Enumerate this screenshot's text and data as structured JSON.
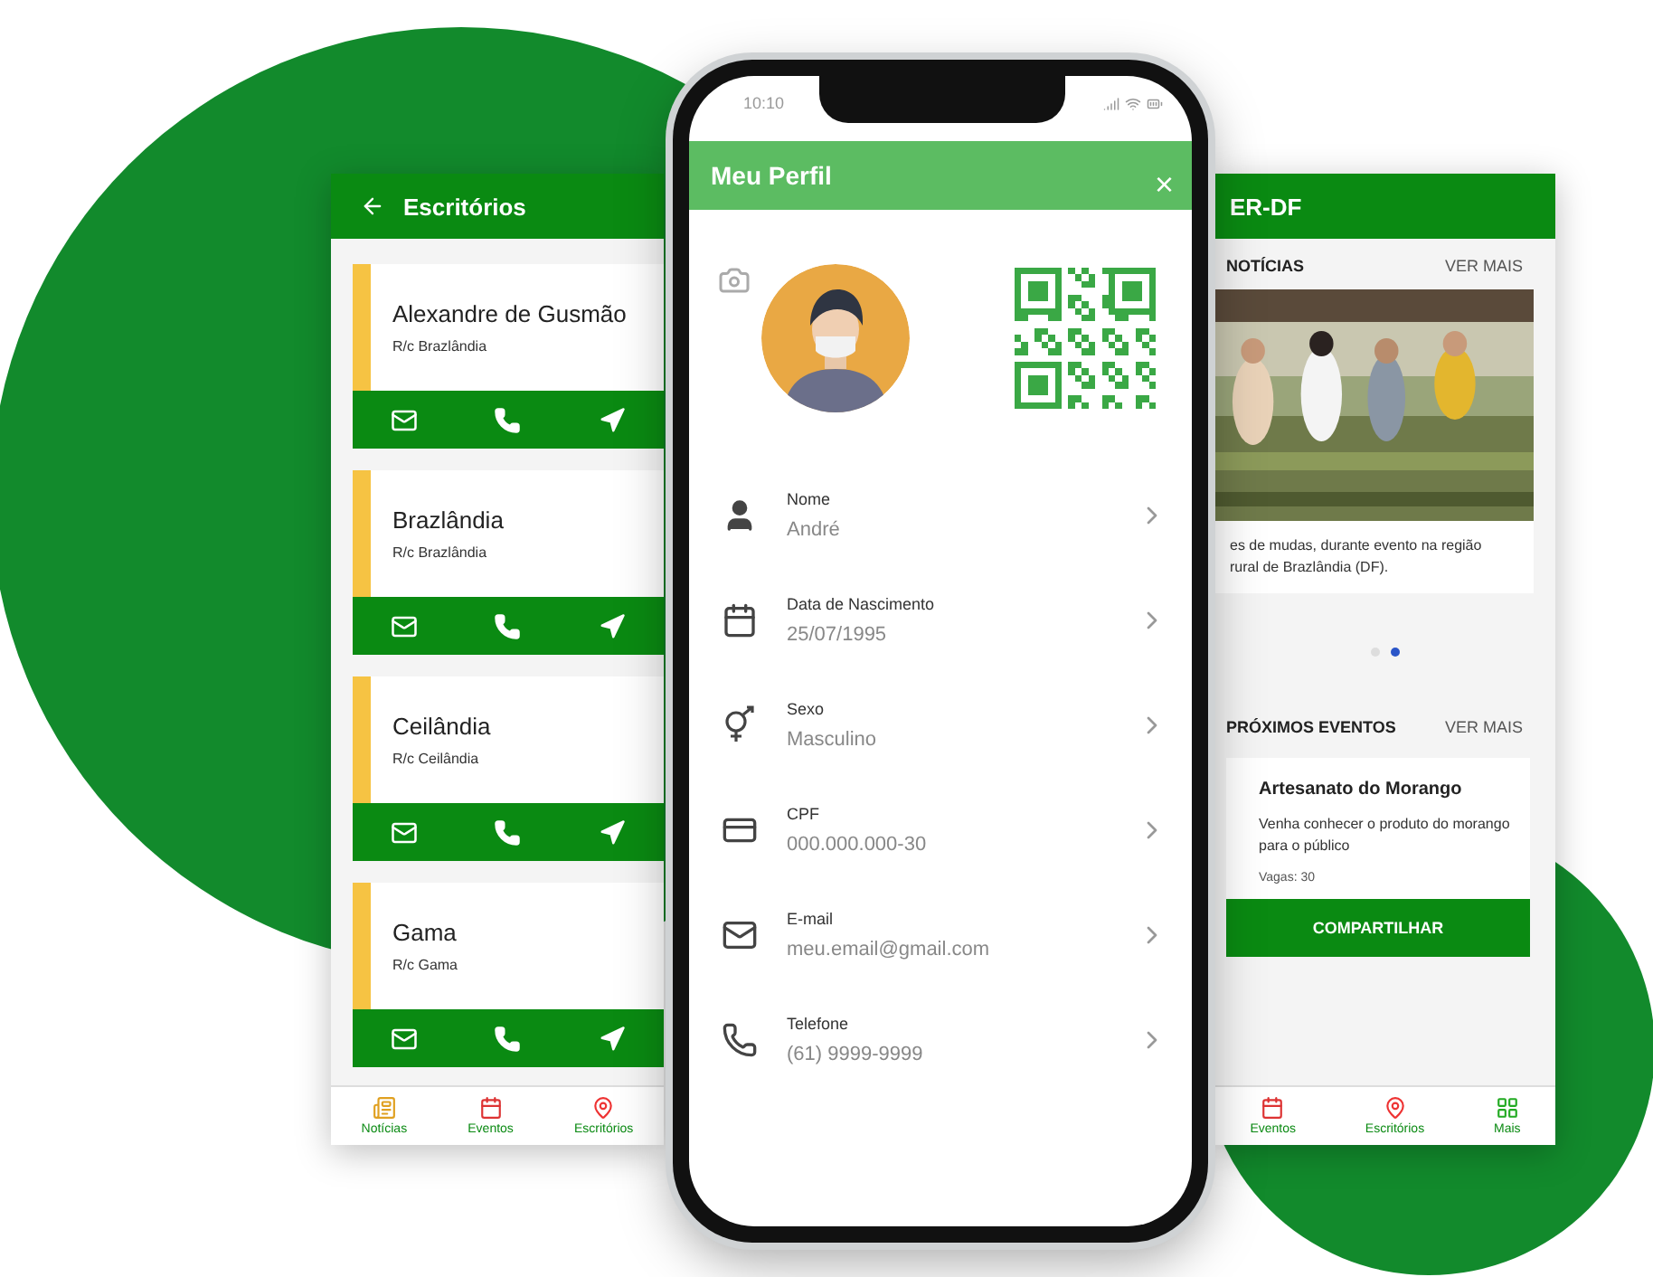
{
  "offices_screen": {
    "title": "Escritórios",
    "offices": [
      {
        "name": "Alexandre de Gusmão",
        "subtitle": "R/c Brazlândia"
      },
      {
        "name": "Brazlândia",
        "subtitle": "R/c Brazlândia"
      },
      {
        "name": "Ceilândia",
        "subtitle": "R/c Ceilândia"
      },
      {
        "name": "Gama",
        "subtitle": "R/c Gama"
      }
    ],
    "nav": [
      {
        "label": "Notícias",
        "kind": "news"
      },
      {
        "label": "Eventos",
        "kind": "calendar"
      },
      {
        "label": "Escritórios",
        "kind": "pin"
      }
    ]
  },
  "profile_screen": {
    "time": "10:10",
    "title": "Meu Perfil",
    "close": "×",
    "fields": [
      {
        "kind": "person",
        "label": "Nome",
        "value": "André"
      },
      {
        "kind": "calendar",
        "label": "Data de Nascimento",
        "value": "25/07/1995"
      },
      {
        "kind": "gender",
        "label": "Sexo",
        "value": "Masculino"
      },
      {
        "kind": "card",
        "label": "CPF",
        "value": "000.000.000-30"
      },
      {
        "kind": "mail",
        "label": "E-mail",
        "value": "meu.email@gmail.com"
      },
      {
        "kind": "phone",
        "label": "Telefone",
        "value": "(61) 9999-9999"
      }
    ]
  },
  "home_screen": {
    "title": "ER-DF",
    "news_heading": "NOTÍCIAS",
    "news_more": "VER MAIS",
    "news_caption": "es de mudas, durante evento na região rural de Brazlândia (DF).",
    "carousel": [
      {
        "selected": false
      },
      {
        "selected": true
      }
    ],
    "events_heading": "PRÓXIMOS EVENTOS",
    "events_more": "VER MAIS",
    "event": {
      "title": "Artesanato do Morango",
      "description": "Venha conhecer o produto do morango para o público",
      "vacancies": "Vagas: 30",
      "button": "COMPARTILHAR"
    },
    "nav": [
      {
        "label": "Eventos",
        "kind": "calendar"
      },
      {
        "label": "Escritórios",
        "kind": "pin"
      },
      {
        "label": "Mais",
        "kind": "grid"
      }
    ]
  }
}
